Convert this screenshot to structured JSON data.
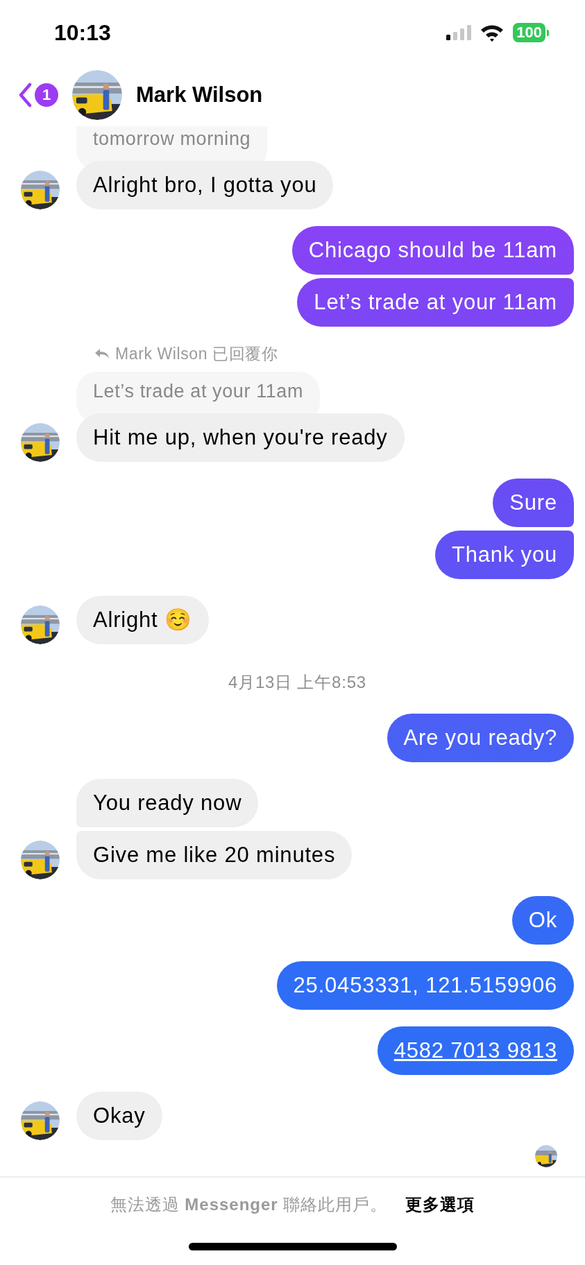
{
  "status_bar": {
    "time": "10:13",
    "battery": "100"
  },
  "header": {
    "back_badge": "1",
    "name": "Mark Wilson"
  },
  "messages": [
    {
      "kind": "incoming",
      "quote": "tomorrow morning",
      "bubbles": [
        "Alright bro, I gotta you"
      ]
    },
    {
      "kind": "outgoing",
      "bubbles": [
        {
          "kind": "text",
          "text": "Chicago should be 11am"
        },
        {
          "kind": "text",
          "text": "Let’s trade at your 11am"
        }
      ]
    },
    {
      "kind": "incoming",
      "reply_label": "Mark Wilson 已回覆你",
      "quote": "Let’s trade at your 11am",
      "bubbles": [
        "Hit me up, when you're ready"
      ]
    },
    {
      "kind": "outgoing",
      "bubbles": [
        {
          "kind": "text",
          "text": "Sure"
        },
        {
          "kind": "text",
          "text": "Thank you"
        }
      ]
    },
    {
      "kind": "incoming",
      "bubbles": [
        "Alright ☺️"
      ]
    },
    {
      "kind": "timestamp",
      "text": "4月13日 上午8:53"
    },
    {
      "kind": "outgoing",
      "bubbles": [
        {
          "kind": "text",
          "text": "Are you ready?"
        }
      ]
    },
    {
      "kind": "incoming",
      "bubbles": [
        "You ready now",
        "Give me like 20 minutes"
      ]
    },
    {
      "kind": "outgoing",
      "bubbles": [
        {
          "kind": "text",
          "text": "Ok"
        }
      ]
    },
    {
      "kind": "outgoing",
      "bubbles": [
        {
          "kind": "text",
          "text": "25.0453331, 121.5159906"
        }
      ]
    },
    {
      "kind": "outgoing",
      "bubbles": [
        {
          "kind": "link",
          "text": "4582 7013 9813"
        }
      ]
    },
    {
      "kind": "incoming",
      "bubbles": [
        "Okay"
      ]
    }
  ],
  "footer": {
    "notice": "無法透過 **Messenger** 聯絡此用戶。",
    "action": "更多選項"
  }
}
